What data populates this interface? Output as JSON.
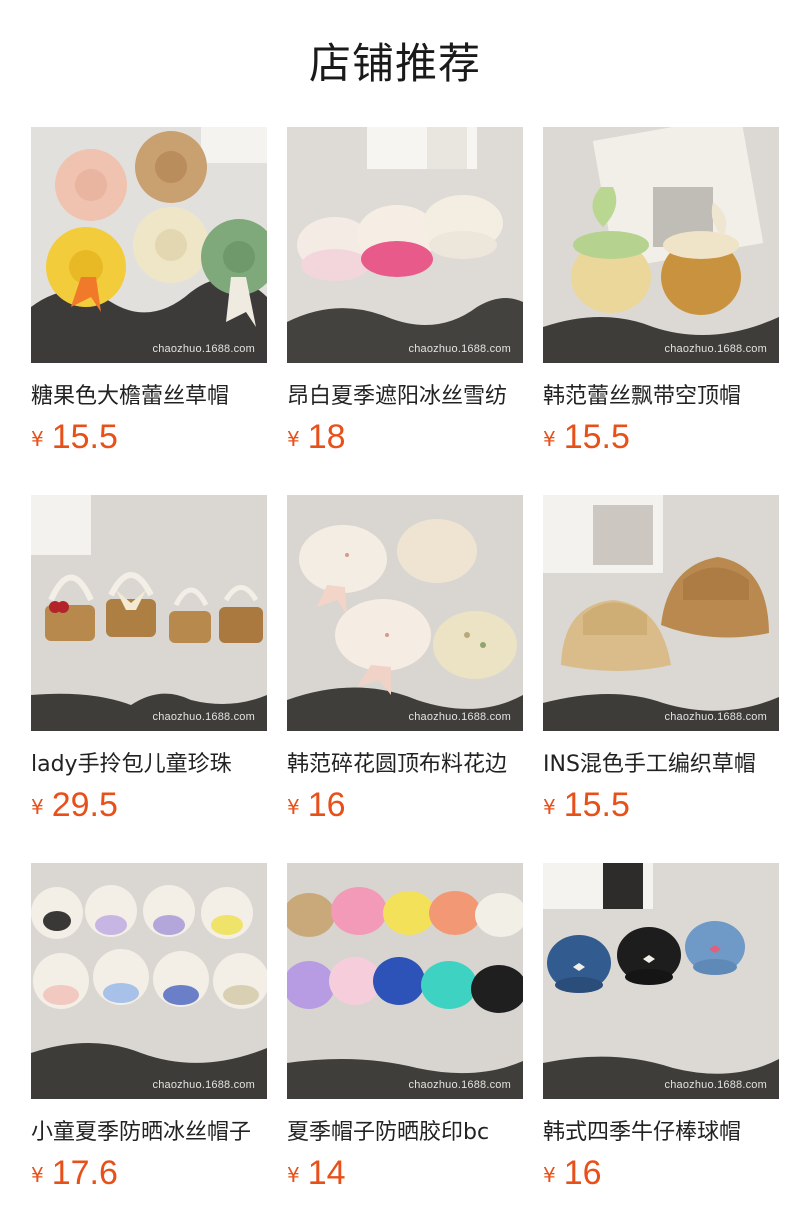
{
  "section": {
    "title": "店铺推荐"
  },
  "currency_symbol": "¥",
  "watermark": "chaozhuo.1688.com",
  "products": [
    {
      "name": "糖果色大檐蕾丝草帽",
      "price": "15.5",
      "image_icon": "straw-sun-hats-image"
    },
    {
      "name": "昂白夏季遮阳冰丝雪纺",
      "price": "18",
      "image_icon": "ruffle-visor-hats-image"
    },
    {
      "name": "韩范蕾丝飘带空顶帽",
      "price": "15.5",
      "image_icon": "lace-visor-hats-image"
    },
    {
      "name": "lady手拎包儿童珍珠",
      "price": "29.5",
      "image_icon": "pearl-basket-bags-image"
    },
    {
      "name": "韩范碎花圆顶布料花边",
      "price": "16",
      "image_icon": "floral-bonnet-hats-image"
    },
    {
      "name": "INS混色手工编织草帽",
      "price": "15.5",
      "image_icon": "knit-bucket-hats-image"
    },
    {
      "name": "小童夏季防晒冰丝帽子",
      "price": "17.6",
      "image_icon": "kids-visor-hats-image"
    },
    {
      "name": "夏季帽子防晒胶印bc",
      "price": "14",
      "image_icon": "colorful-baseball-caps-image"
    },
    {
      "name": "韩式四季牛仔棒球帽",
      "price": "16",
      "image_icon": "denim-baseball-caps-image"
    }
  ],
  "colors": {
    "price": "#e8501a",
    "title": "#1a1a1a"
  }
}
